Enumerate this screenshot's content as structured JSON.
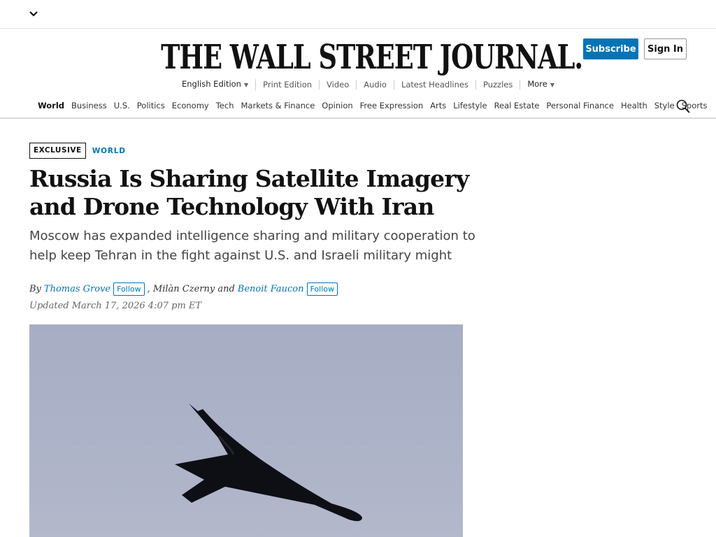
{
  "masthead": {
    "title": "THE WALL STREET JOURNAL."
  },
  "account": {
    "subscribe_label": "Subscribe",
    "signin_label": "Sign In"
  },
  "subnav": {
    "edition": "English Edition",
    "items": [
      "Print Edition",
      "Video",
      "Audio",
      "Latest Headlines",
      "Puzzles"
    ],
    "more": "More"
  },
  "mainnav": {
    "items": [
      "World",
      "Business",
      "U.S.",
      "Politics",
      "Economy",
      "Tech",
      "Markets & Finance",
      "Opinion",
      "Free Expression",
      "Arts",
      "Lifestyle",
      "Real Estate",
      "Personal Finance",
      "Health",
      "Style",
      "Sports"
    ],
    "active": "World"
  },
  "article": {
    "flag": "EXCLUSIVE",
    "section": "WORLD",
    "headline": "Russia Is Sharing Satellite Imagery and Drone Technology With Iran",
    "dek": "Moscow has expanded intelligence sharing and military cooperation to help keep Tehran in the fight against U.S. and Israeli military might",
    "byline": {
      "prefix": "By",
      "author1": "Thomas Grove",
      "follow_label": "Follow",
      "sep": ", Milàn Czerny and",
      "author2": "Benoit Faucon"
    },
    "updated": "Updated March 17, 2026 4:07 pm ET"
  },
  "colors": {
    "accent": "#0274b6",
    "text": "#111111",
    "sky": "#aab0c6"
  },
  "icons": {
    "menu_toggle": "chevron-down-icon",
    "search": "search-icon",
    "photo": "drone-image"
  }
}
